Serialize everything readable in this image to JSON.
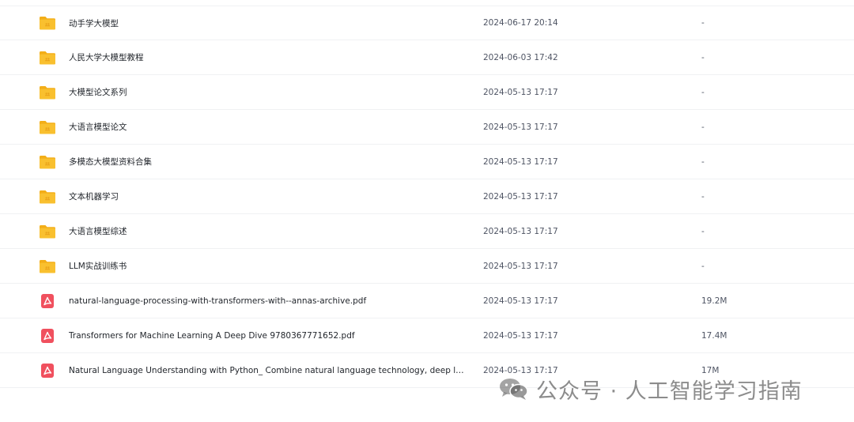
{
  "files": [
    {
      "name": "动手学大模型",
      "modified": "2024-06-17 20:14",
      "size": "-",
      "icon": "folder-icon"
    },
    {
      "name": "人民大学大模型教程",
      "modified": "2024-06-03 17:42",
      "size": "-",
      "icon": "folder-icon"
    },
    {
      "name": "大模型论文系列",
      "modified": "2024-05-13 17:17",
      "size": "-",
      "icon": "folder-icon"
    },
    {
      "name": "大语言模型论文",
      "modified": "2024-05-13 17:17",
      "size": "-",
      "icon": "folder-icon"
    },
    {
      "name": "多模态大模型资料合集",
      "modified": "2024-05-13 17:17",
      "size": "-",
      "icon": "folder-icon"
    },
    {
      "name": "文本机器学习",
      "modified": "2024-05-13 17:17",
      "size": "-",
      "icon": "folder-icon"
    },
    {
      "name": "大语言模型综述",
      "modified": "2024-05-13 17:17",
      "size": "-",
      "icon": "folder-icon"
    },
    {
      "name": "LLM实战训练书",
      "modified": "2024-05-13 17:17",
      "size": "-",
      "icon": "folder-icon"
    },
    {
      "name": "natural-language-processing-with-transformers-with--annas-archive.pdf",
      "modified": "2024-05-13 17:17",
      "size": "19.2M",
      "icon": "pdf-icon"
    },
    {
      "name": "Transformers for Machine Learning A Deep Dive 9780367771652.pdf",
      "modified": "2024-05-13 17:17",
      "size": "17.4M",
      "icon": "pdf-icon"
    },
    {
      "name": "Natural Language Understanding with Python_ Combine natural language technology, deep learnin...",
      "modified": "2024-05-13 17:17",
      "size": "17M",
      "icon": "pdf-icon"
    }
  ],
  "watermark": {
    "text": "公众号 · 人工智能学习指南",
    "icon": "wechat-icon"
  },
  "colors": {
    "folder": "#f9c02f",
    "folder_back": "#f3ae18",
    "pdf": "#f0505e"
  }
}
